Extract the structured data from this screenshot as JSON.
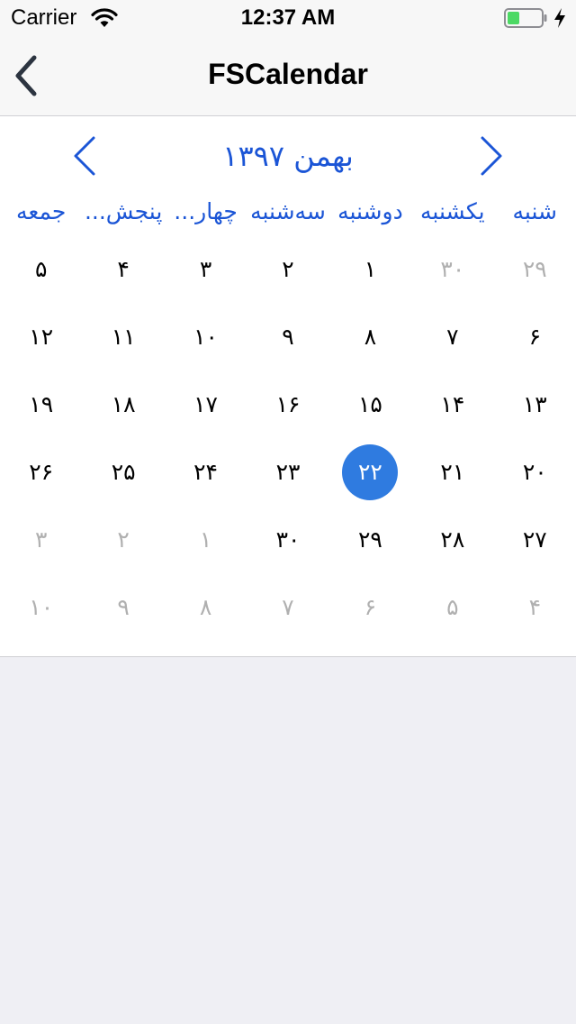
{
  "status_bar": {
    "carrier": "Carrier",
    "time": "12:37 AM",
    "wifi_icon": "wifi-icon",
    "battery_icon": "battery-icon",
    "battery_level": 0.35,
    "charging_icon": "bolt-icon"
  },
  "nav": {
    "back_icon": "chevron-left-icon",
    "title": "FSCalendar"
  },
  "calendar": {
    "month_title": "بهمن ۱۳۹۷",
    "prev_icon": "chevron-left-icon",
    "next_icon": "chevron-right-icon",
    "weekdays": [
      "جمعه",
      "پنجش...",
      "چهار...",
      "سه‌شنبه",
      "دوشنبه",
      "یکشنبه",
      "شنبه"
    ],
    "weeks": [
      [
        {
          "d": "۵"
        },
        {
          "d": "۴"
        },
        {
          "d": "۳"
        },
        {
          "d": "۲"
        },
        {
          "d": "۱"
        },
        {
          "d": "۳۰",
          "other": true
        },
        {
          "d": "۲۹",
          "other": true
        }
      ],
      [
        {
          "d": "۱۲"
        },
        {
          "d": "۱۱"
        },
        {
          "d": "۱۰"
        },
        {
          "d": "۹"
        },
        {
          "d": "۸"
        },
        {
          "d": "۷"
        },
        {
          "d": "۶"
        }
      ],
      [
        {
          "d": "۱۹"
        },
        {
          "d": "۱۸"
        },
        {
          "d": "۱۷"
        },
        {
          "d": "۱۶"
        },
        {
          "d": "۱۵"
        },
        {
          "d": "۱۴"
        },
        {
          "d": "۱۳"
        }
      ],
      [
        {
          "d": "۲۶"
        },
        {
          "d": "۲۵"
        },
        {
          "d": "۲۴"
        },
        {
          "d": "۲۳"
        },
        {
          "d": "۲۲",
          "today": true
        },
        {
          "d": "۲۱"
        },
        {
          "d": "۲۰"
        }
      ],
      [
        {
          "d": "۳",
          "other": true
        },
        {
          "d": "۲",
          "other": true
        },
        {
          "d": "۱",
          "other": true
        },
        {
          "d": "۳۰"
        },
        {
          "d": "۲۹"
        },
        {
          "d": "۲۸"
        },
        {
          "d": "۲۷"
        }
      ],
      [
        {
          "d": "۱۰",
          "other": true
        },
        {
          "d": "۹",
          "other": true
        },
        {
          "d": "۸",
          "other": true
        },
        {
          "d": "۷",
          "other": true
        },
        {
          "d": "۶",
          "other": true
        },
        {
          "d": "۵",
          "other": true
        },
        {
          "d": "۴",
          "other": true
        }
      ]
    ]
  },
  "colors": {
    "accent": "#1b55d6",
    "today_fill": "#2f7be0",
    "other_month_text": "#b0b0b0",
    "battery_green": "#4cd964"
  }
}
